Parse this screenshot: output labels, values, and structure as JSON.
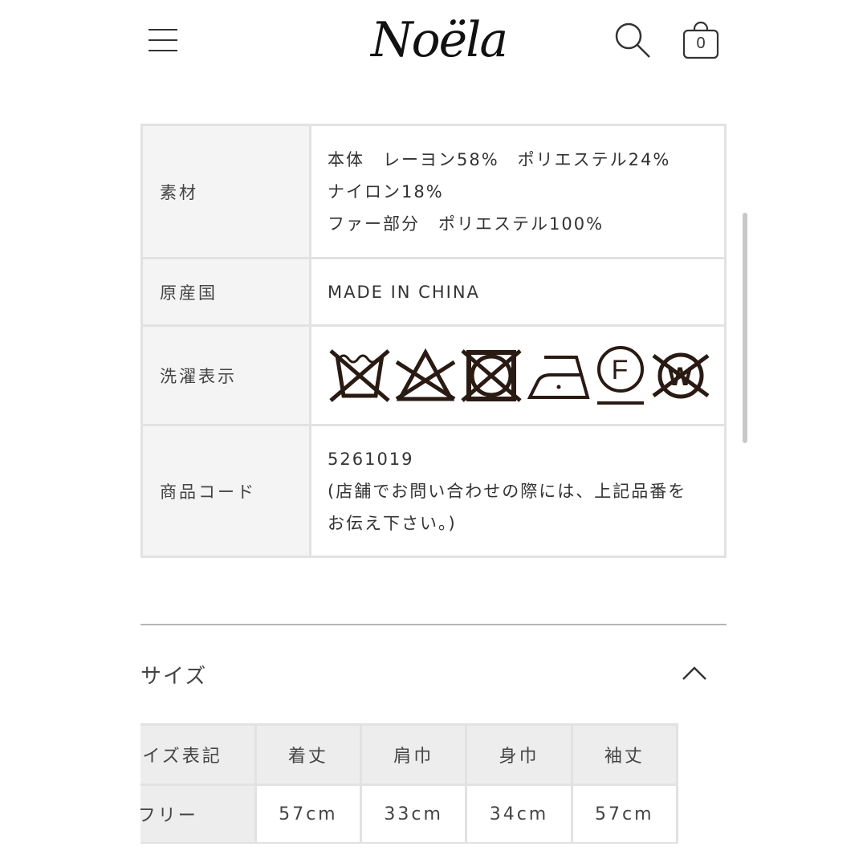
{
  "header": {
    "brand": "Noëla",
    "menu_icon": "hamburger-menu-icon",
    "search_icon": "search-icon",
    "cart_icon": "shopping-bag-icon",
    "cart_count": "0"
  },
  "spec_table": {
    "rows": [
      {
        "label": "素材",
        "lines": [
          "本体　レーヨン58%　ポリエステル24%",
          "ナイロン18%",
          "ファー部分　ポリエステル100%"
        ]
      },
      {
        "label": "原産国",
        "value": "MADE IN CHINA"
      },
      {
        "label": "洗濯表示",
        "care_icons": [
          "do-not-wash-icon",
          "do-not-bleach-icon",
          "do-not-tumble-dry-icon",
          "iron-low-temperature-icon",
          "dry-clean-f-mild-icon",
          "do-not-wet-clean-icon"
        ]
      },
      {
        "label": "商品コード",
        "lines": [
          "5261019",
          "(店舗でお問い合わせの際には、上記品番を",
          "お伝え下さい。)"
        ]
      }
    ]
  },
  "size_section": {
    "title": "サイズ",
    "toggle_icon": "chevron-up-icon",
    "headers": [
      "サイズ表記",
      "着丈",
      "肩巾",
      "身巾",
      "袖丈"
    ],
    "rows": [
      [
        "フリー",
        "57cm",
        "33cm",
        "34cm",
        "57cm"
      ]
    ]
  }
}
